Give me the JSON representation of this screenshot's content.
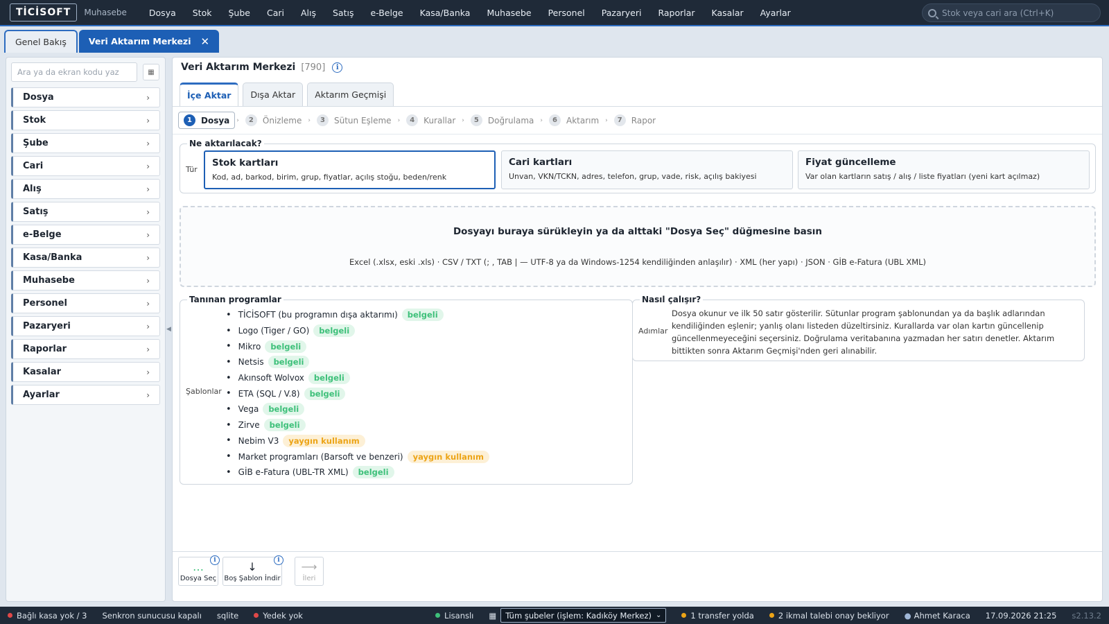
{
  "app": {
    "logo": "TİCİSOFT",
    "module": "Muhasebe"
  },
  "menu": [
    "Dosya",
    "Stok",
    "Şube",
    "Cari",
    "Alış",
    "Satış",
    "e-Belge",
    "Kasa/Banka",
    "Muhasebe",
    "Personel",
    "Pazaryeri",
    "Raporlar",
    "Kasalar",
    "Ayarlar"
  ],
  "search": {
    "placeholder": "Stok veya cari ara (Ctrl+K)"
  },
  "tabs": {
    "overview": "Genel Bakış",
    "current": "Veri Aktarım Merkezi",
    "close": "✕"
  },
  "sidebar": {
    "search_placeholder": "Ara ya da ekran kodu yaz",
    "items": [
      "Dosya",
      "Stok",
      "Şube",
      "Cari",
      "Alış",
      "Satış",
      "e-Belge",
      "Kasa/Banka",
      "Muhasebe",
      "Personel",
      "Pazaryeri",
      "Raporlar",
      "Kasalar",
      "Ayarlar"
    ]
  },
  "panel": {
    "title": "Veri Aktarım Merkezi",
    "code": "[790]",
    "subtabs": [
      "İçe Aktar",
      "Dışa Aktar",
      "Aktarım Geçmişi"
    ],
    "steps": [
      {
        "n": "1",
        "label": "Dosya"
      },
      {
        "n": "2",
        "label": "Önizleme"
      },
      {
        "n": "3",
        "label": "Sütun Eşleme"
      },
      {
        "n": "4",
        "label": "Kurallar"
      },
      {
        "n": "5",
        "label": "Doğrulama"
      },
      {
        "n": "6",
        "label": "Aktarım"
      },
      {
        "n": "7",
        "label": "Rapor"
      }
    ]
  },
  "what": {
    "legend": "Ne aktarılacak?",
    "side": "Tür",
    "cards": [
      {
        "title": "Stok kartları",
        "desc": "Kod, ad, barkod, birim, grup, fiyatlar, açılış stoğu, beden/renk"
      },
      {
        "title": "Cari kartları",
        "desc": "Unvan, VKN/TCKN, adres, telefon, grup, vade, risk, açılış bakiyesi"
      },
      {
        "title": "Fiyat güncelleme",
        "desc": "Var olan kartların satış / alış / liste fiyatları (yeni kart açılmaz)"
      }
    ]
  },
  "dropzone": {
    "headline": "Dosyayı buraya sürükleyin ya da alttaki \"Dosya Seç\" düğmesine basın",
    "formats": "Excel (.xlsx, eski .xls) · CSV / TXT (; , TAB | — UTF-8 ya da Windows-1254 kendiliğinden anlaşılır) · XML (her yapı) · JSON · GİB e-Fatura (UBL XML)"
  },
  "programs": {
    "legend": "Tanınan programlar",
    "side": "Şablonlar",
    "items": [
      {
        "name": "TİCİSOFT (bu programın dışa aktarımı)",
        "badge": "belgeli",
        "kind": "ok"
      },
      {
        "name": "Logo (Tiger / GO)",
        "badge": "belgeli",
        "kind": "ok"
      },
      {
        "name": "Mikro",
        "badge": "belgeli",
        "kind": "ok"
      },
      {
        "name": "Netsis",
        "badge": "belgeli",
        "kind": "ok"
      },
      {
        "name": "Akınsoft Wolvox",
        "badge": "belgeli",
        "kind": "ok"
      },
      {
        "name": "ETA (SQL / V.8)",
        "badge": "belgeli",
        "kind": "ok"
      },
      {
        "name": "Vega",
        "badge": "belgeli",
        "kind": "ok"
      },
      {
        "name": "Zirve",
        "badge": "belgeli",
        "kind": "ok"
      },
      {
        "name": "Nebim V3",
        "badge": "yaygın kullanım",
        "kind": "common"
      },
      {
        "name": "Market programları (Barsoft ve benzeri)",
        "badge": "yaygın kullanım",
        "kind": "common"
      },
      {
        "name": "GİB e-Fatura (UBL-TR XML)",
        "badge": "belgeli",
        "kind": "ok"
      }
    ]
  },
  "how": {
    "legend": "Nasıl çalışır?",
    "side": "Adımlar",
    "text": "Dosya okunur ve ilk 50 satır gösterilir. Sütunlar program şablonundan ya da başlık adlarından kendiliğinden eşlenir; yanlış olanı listeden düzeltirsiniz. Kurallarda var olan kartın güncellenip güncellenmeyeceğini seçersiniz. Doğrulama veritabanına yazmadan her satırı denetler. Aktarım bittikten sonra Aktarım Geçmişi'nden geri alınabilir."
  },
  "toolbar": {
    "choose_file": "Dosya Seç",
    "empty_template": "Boş Şablon İndir",
    "next": "İleri",
    "choose_glyph": "…",
    "template_glyph": "↓",
    "next_glyph": "⟶",
    "info": "i"
  },
  "status": {
    "till": "Bağlı kasa yok / 3",
    "sync": "Senkron sunucusu kapalı",
    "db": "sqlite",
    "backup": "Yedek yok",
    "license": "Lisanslı",
    "branch": "Tüm şubeler (işlem: Kadıköy Merkez)",
    "transfer": "1 transfer yolda",
    "approval": "2 ikmal talebi onay bekliyor",
    "user": "Ahmet Karaca",
    "datetime": "17.09.2026 21:25",
    "version": "s2.13.2"
  },
  "colors": {
    "accent": "#1d5fb5",
    "ok": "#3ec07a",
    "warn": "#eca417",
    "danger": "#e04848",
    "nav": "#1f2a38"
  }
}
